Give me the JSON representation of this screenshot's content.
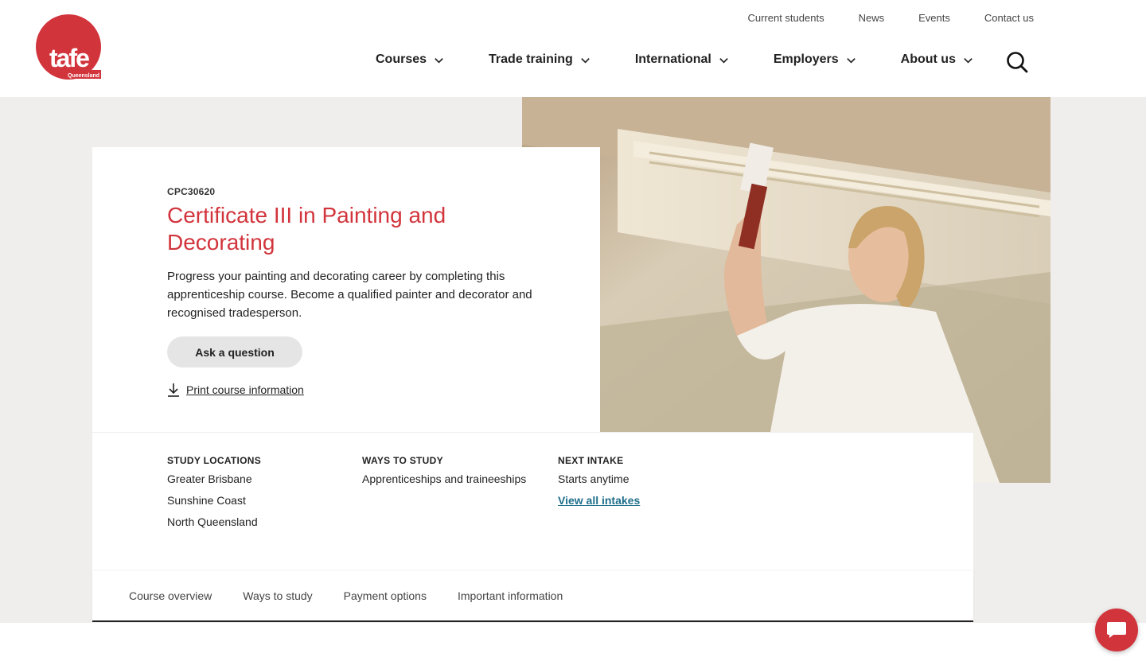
{
  "brand": {
    "name": "tafe",
    "subname": "Queensland",
    "color": "#d2343c"
  },
  "utility_nav": [
    "Current students",
    "News",
    "Events",
    "Contact us"
  ],
  "main_nav": [
    {
      "label": "Courses"
    },
    {
      "label": "Trade training"
    },
    {
      "label": "International"
    },
    {
      "label": "Employers"
    },
    {
      "label": "About us"
    }
  ],
  "search": {
    "icon": "search-icon"
  },
  "course": {
    "code": "CPC30620",
    "title": "Certificate III in Painting and Decorating",
    "description": "Progress your painting and decorating career by completing this apprenticeship course. Become a qualified painter and decorator and recognised tradesperson.",
    "ask_button": "Ask a question",
    "print_link": "Print course information"
  },
  "info": {
    "locations": {
      "heading": "STUDY LOCATIONS",
      "items": [
        "Greater Brisbane",
        "Sunshine Coast",
        "North Queensland"
      ]
    },
    "ways": {
      "heading": "WAYS TO STUDY",
      "items": [
        "Apprenticeships and traineeships"
      ]
    },
    "intake": {
      "heading": "NEXT INTAKE",
      "value": "Starts anytime",
      "link": "View all intakes"
    }
  },
  "tabs": [
    "Course overview",
    "Ways to study",
    "Payment options",
    "Important information"
  ],
  "chat": {
    "icon": "chat-icon"
  }
}
